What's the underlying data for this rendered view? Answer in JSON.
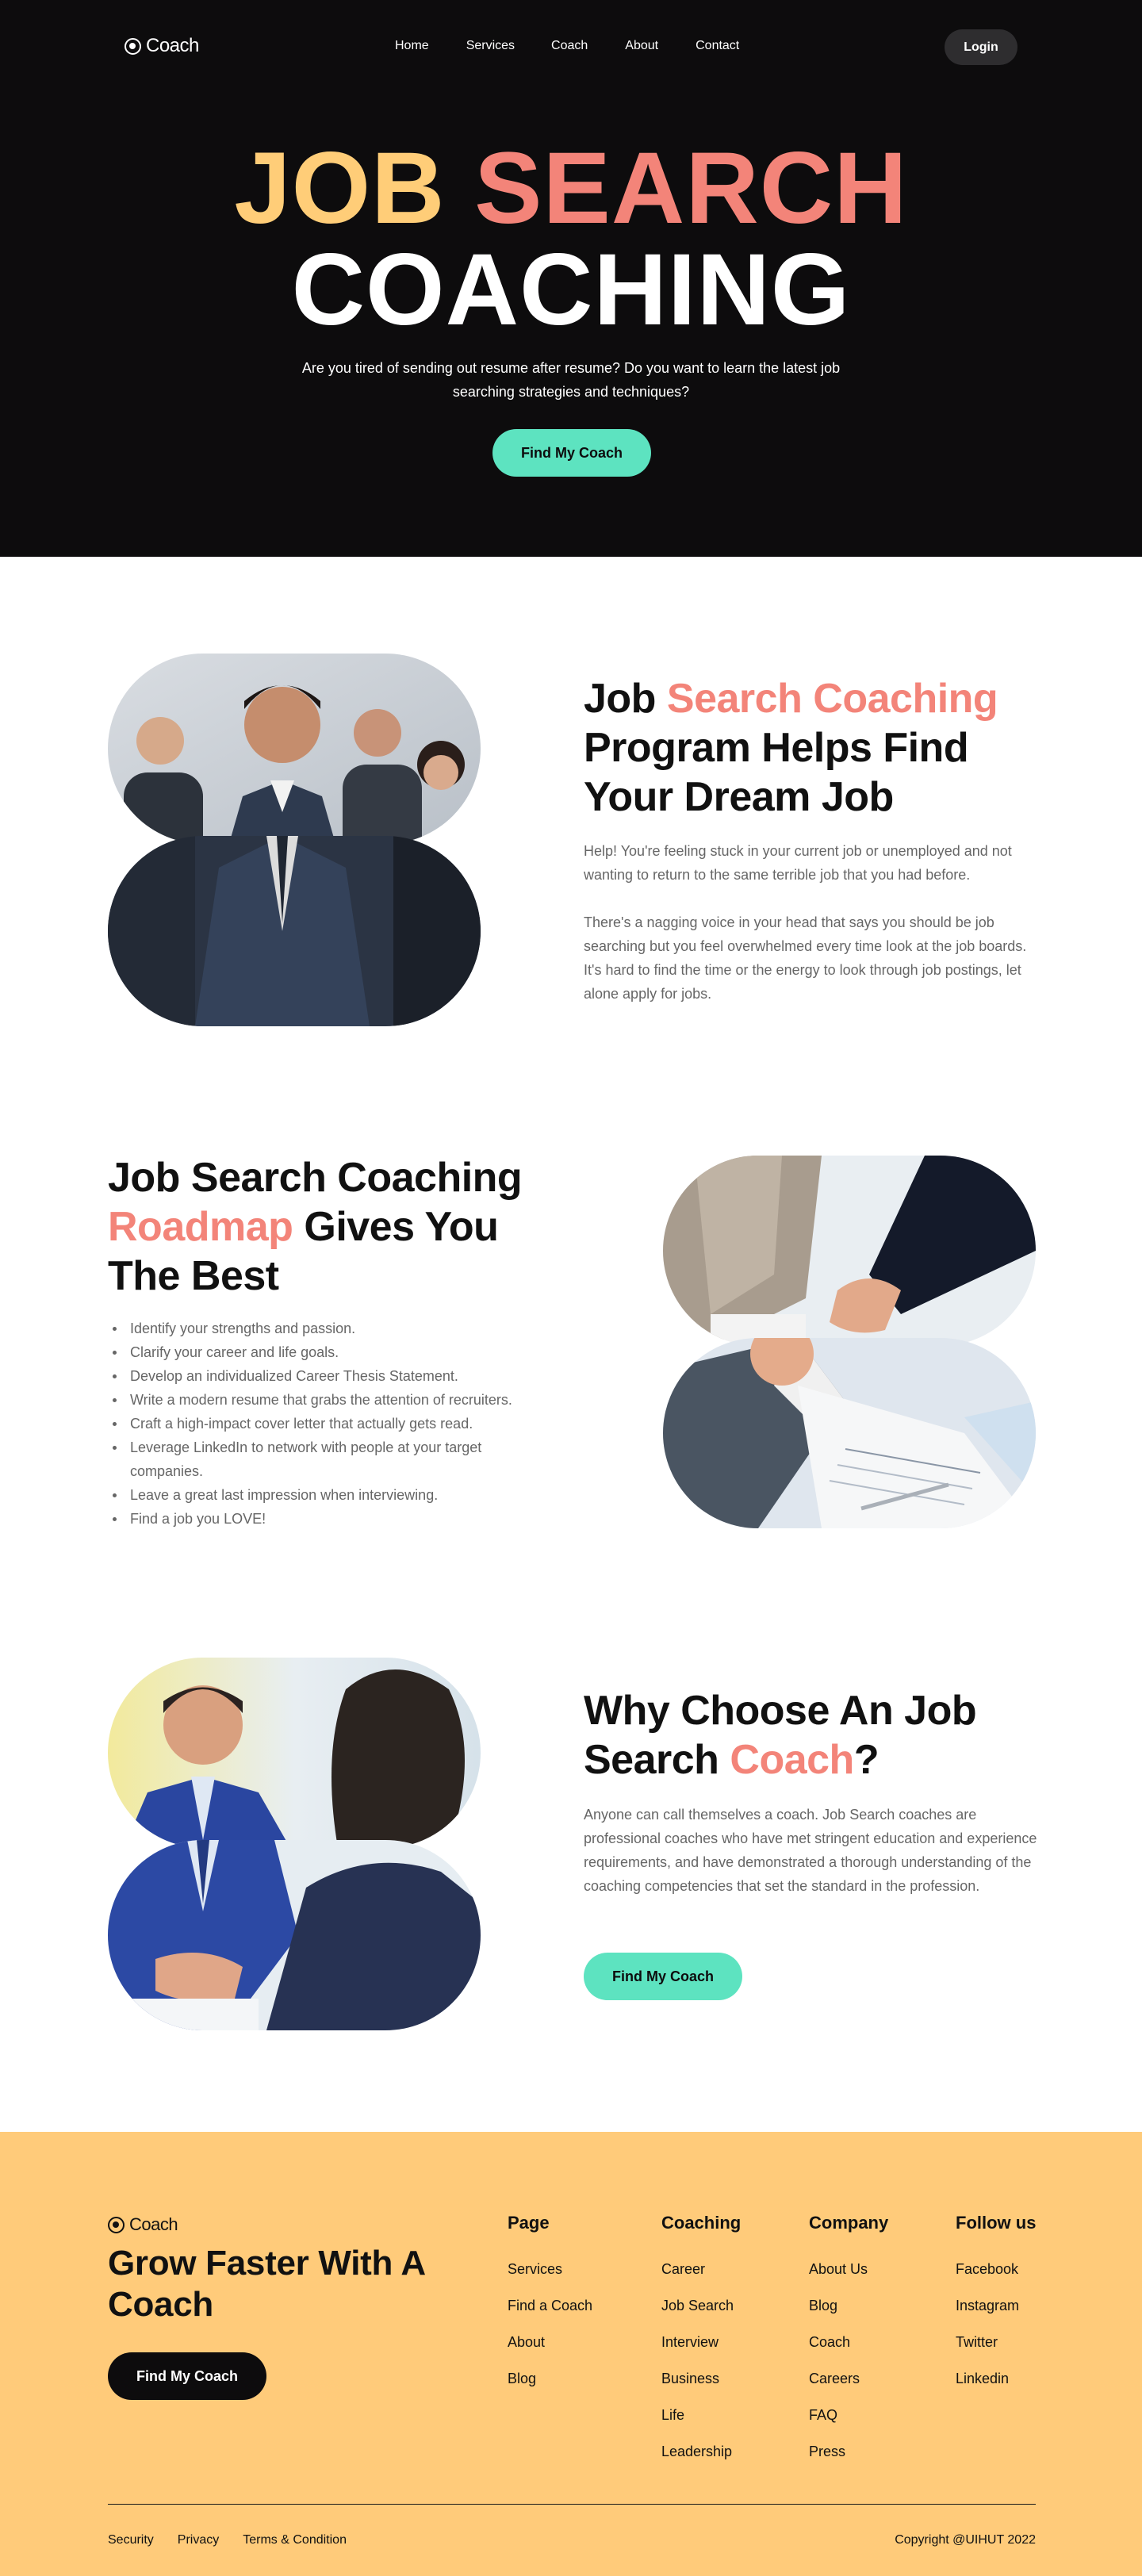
{
  "header": {
    "logo": "Coach",
    "nav": [
      "Home",
      "Services",
      "Coach",
      "About",
      "Contact"
    ],
    "login": "Login"
  },
  "hero": {
    "title_word1": "JOB",
    "title_word2": "SEARCH",
    "title_line2": "COACHING",
    "subtitle": "Are you tired of sending out resume after resume? Do you want to learn the latest job searching strategies and techniques?",
    "cta": "Find My Coach"
  },
  "section1": {
    "title_a": "Job ",
    "title_accent": "Search Coaching",
    "title_b": " Program Helps Find Your Dream Job",
    "para1": "Help! You're feeling stuck in your current job or unemployed and not wanting to return to the same terrible job that you had before.",
    "para2": "There's a nagging voice in your head that says you should be job searching but you feel overwhelmed every time look at the job boards. It's hard to find the time or the energy to look through job postings, let alone apply for jobs."
  },
  "section2": {
    "title_a": "Job Search Coaching ",
    "title_accent": "Roadmap",
    "title_b": " Gives You The Best",
    "items": [
      "Identify your strengths and passion.",
      "Clarify your career and life goals.",
      "Develop an individualized Career Thesis Statement.",
      "Write a modern resume that grabs the attention of recruiters.",
      "Craft a high-impact cover letter that actually gets read.",
      "Leverage LinkedIn to network with people at your target companies.",
      "Leave a great last impression when interviewing.",
      "Find a job you LOVE!"
    ]
  },
  "section3": {
    "title_a": "Why Choose An Job Search ",
    "title_accent": "Coach",
    "title_b": "?",
    "para": "Anyone can call themselves a coach. Job Search coaches are professional coaches who have met stringent education and experience requirements, and have demonstrated a thorough understanding of the coaching competencies that set the standard in the profession.",
    "cta": "Find My Coach"
  },
  "footer": {
    "logo": "Coach",
    "tagline": "Grow Faster With A Coach",
    "cta": "Find My Coach",
    "columns": [
      {
        "title": "Page",
        "links": [
          "Services",
          "Find a Coach",
          "About",
          "Blog"
        ]
      },
      {
        "title": "Coaching",
        "links": [
          "Career",
          "Job Search",
          "Interview",
          "Business",
          "Life",
          "Leadership"
        ]
      },
      {
        "title": "Company",
        "links": [
          "About Us",
          "Blog",
          "Coach",
          "Careers",
          "FAQ",
          "Press"
        ]
      },
      {
        "title": "Follow us",
        "links": [
          "Facebook",
          "Instagram",
          "Twitter",
          "Linkedin"
        ]
      }
    ],
    "legal": [
      "Security",
      "Privacy",
      "Terms & Condition"
    ],
    "copyright": "Copyright @UIHUT 2022"
  },
  "colors": {
    "hero_bg": "#0d0c0d",
    "accent_yellow": "#ffcd78",
    "accent_salmon": "#f38479",
    "cta_mint": "#5de3c0",
    "footer_bg": "#ffcb7a"
  }
}
